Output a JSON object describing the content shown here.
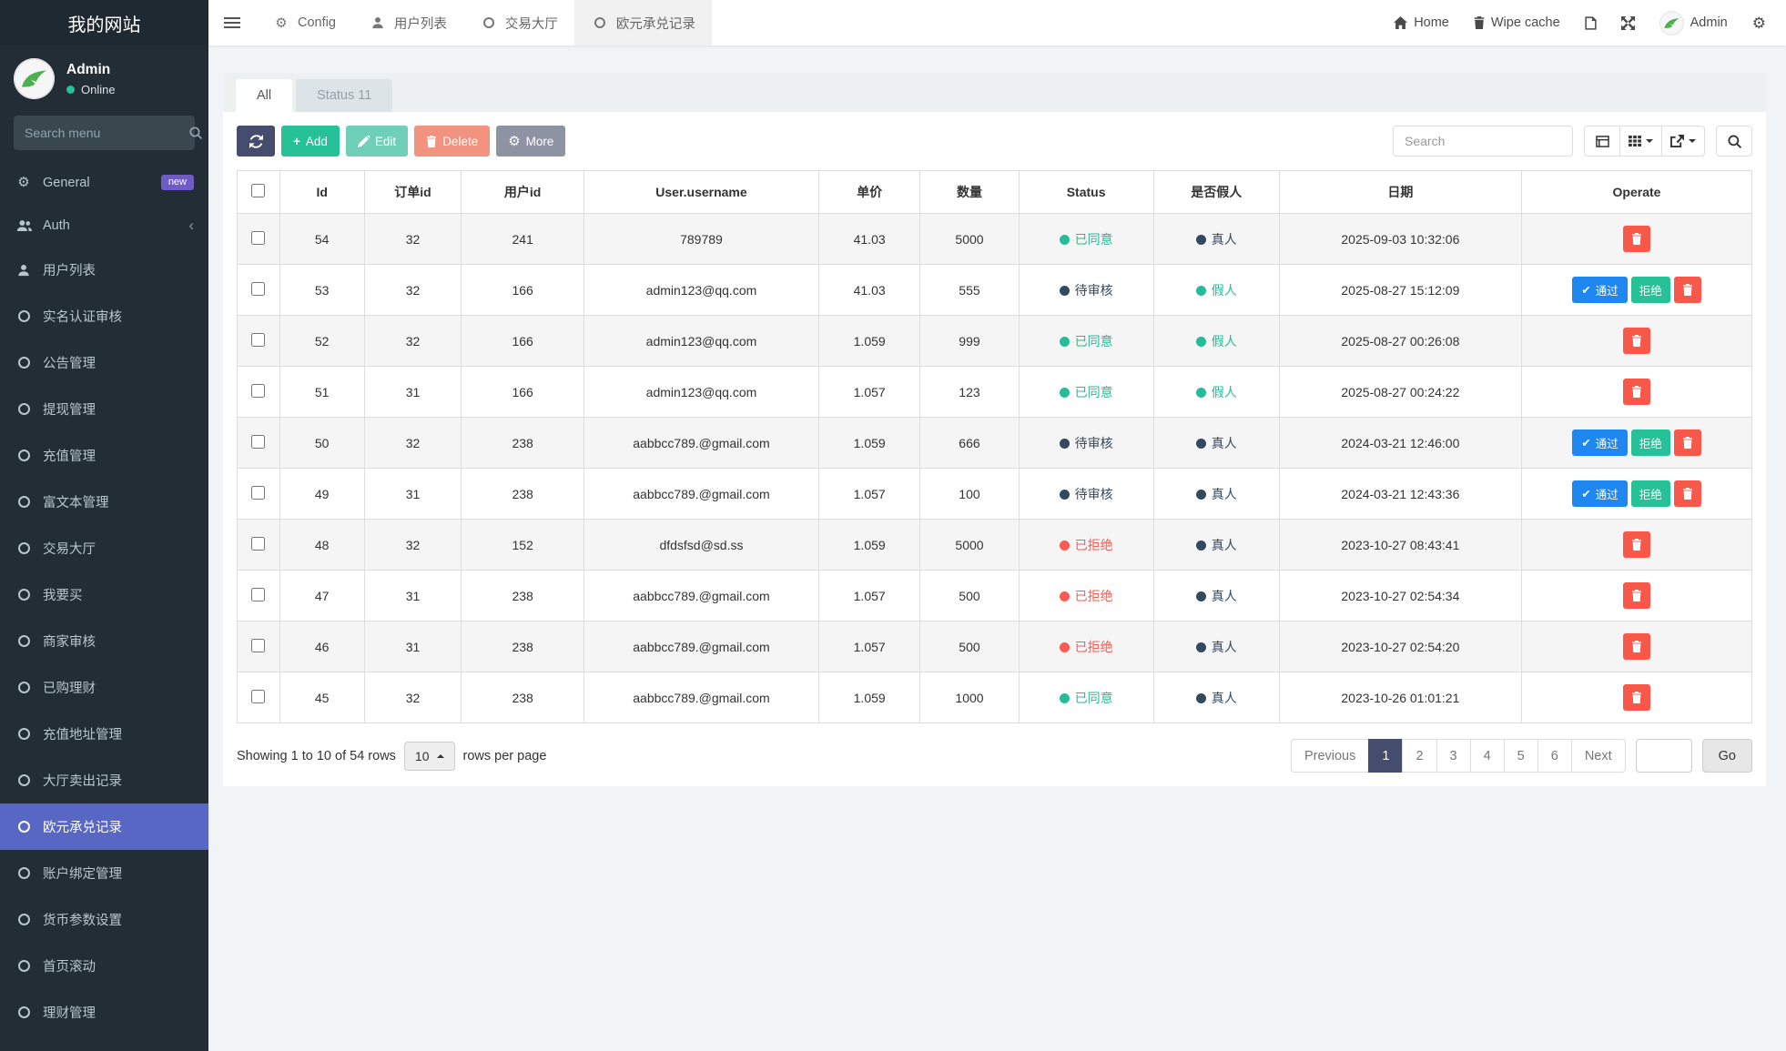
{
  "sidebar": {
    "title": "我的网站",
    "user": {
      "name": "Admin",
      "status": "Online"
    },
    "search_placeholder": "Search menu",
    "items": [
      {
        "label": "General",
        "icon": "gears-icon",
        "badge": "new"
      },
      {
        "label": "Auth",
        "icon": "users-icon",
        "chevron": true
      },
      {
        "label": "用户列表",
        "icon": "user-icon"
      },
      {
        "label": "实名认证审核",
        "icon": "circle-icon"
      },
      {
        "label": "公告管理",
        "icon": "circle-icon"
      },
      {
        "label": "提现管理",
        "icon": "circle-icon"
      },
      {
        "label": "充值管理",
        "icon": "circle-icon"
      },
      {
        "label": "富文本管理",
        "icon": "circle-icon"
      },
      {
        "label": "交易大厅",
        "icon": "circle-icon"
      },
      {
        "label": "我要买",
        "icon": "circle-icon"
      },
      {
        "label": "商家审核",
        "icon": "circle-icon"
      },
      {
        "label": "已购理财",
        "icon": "circle-icon"
      },
      {
        "label": "充值地址管理",
        "icon": "circle-icon"
      },
      {
        "label": "大厅卖出记录",
        "icon": "circle-icon"
      },
      {
        "label": "欧元承兑记录",
        "icon": "circle-icon",
        "active": true
      },
      {
        "label": "账户绑定管理",
        "icon": "circle-icon"
      },
      {
        "label": "货币参数设置",
        "icon": "circle-icon"
      },
      {
        "label": "首页滚动",
        "icon": "circle-icon"
      },
      {
        "label": "理财管理",
        "icon": "circle-icon"
      }
    ]
  },
  "topbar": {
    "tabs": [
      {
        "label": "Config",
        "icon": "gear-icon"
      },
      {
        "label": "用户列表",
        "icon": "user-icon"
      },
      {
        "label": "交易大厅",
        "icon": "circle-icon"
      },
      {
        "label": "欧元承兑记录",
        "icon": "circle-icon",
        "active": true
      }
    ],
    "home_label": "Home",
    "wipe_cache_label": "Wipe cache",
    "admin_label": "Admin"
  },
  "panel": {
    "tabs": [
      {
        "label": "All",
        "active": true
      },
      {
        "label": "Status 11"
      }
    ],
    "toolbar": {
      "add": "Add",
      "edit": "Edit",
      "delete": "Delete",
      "more": "More",
      "search_placeholder": "Search"
    }
  },
  "table": {
    "columns": [
      "Id",
      "订单id",
      "用户id",
      "User.username",
      "单价",
      "数量",
      "Status",
      "是否假人",
      "日期",
      "Operate"
    ],
    "operate_labels": {
      "approve": "通过",
      "reject": "拒绝"
    },
    "status_colors": {
      "green": "#26bd96",
      "dark": "#34495e",
      "red": "#fa5a51"
    },
    "rows": [
      {
        "id": "54",
        "order_id": "32",
        "user_id": "241",
        "username": "789789",
        "price": "41.03",
        "qty": "5000",
        "status": {
          "label": "已同意",
          "type": "green"
        },
        "fake": {
          "label": "真人",
          "type": "dark"
        },
        "date": "2025-09-03 10:32:06",
        "can_review": false
      },
      {
        "id": "53",
        "order_id": "32",
        "user_id": "166",
        "username": "admin123@qq.com",
        "price": "41.03",
        "qty": "555",
        "status": {
          "label": "待审核",
          "type": "dark"
        },
        "fake": {
          "label": "假人",
          "type": "green"
        },
        "date": "2025-08-27 15:12:09",
        "can_review": true
      },
      {
        "id": "52",
        "order_id": "32",
        "user_id": "166",
        "username": "admin123@qq.com",
        "price": "1.059",
        "qty": "999",
        "status": {
          "label": "已同意",
          "type": "green"
        },
        "fake": {
          "label": "假人",
          "type": "green"
        },
        "date": "2025-08-27 00:26:08",
        "can_review": false
      },
      {
        "id": "51",
        "order_id": "31",
        "user_id": "166",
        "username": "admin123@qq.com",
        "price": "1.057",
        "qty": "123",
        "status": {
          "label": "已同意",
          "type": "green"
        },
        "fake": {
          "label": "假人",
          "type": "green"
        },
        "date": "2025-08-27 00:24:22",
        "can_review": false
      },
      {
        "id": "50",
        "order_id": "32",
        "user_id": "238",
        "username": "aabbcc789.@gmail.com",
        "price": "1.059",
        "qty": "666",
        "status": {
          "label": "待审核",
          "type": "dark"
        },
        "fake": {
          "label": "真人",
          "type": "dark"
        },
        "date": "2024-03-21 12:46:00",
        "can_review": true
      },
      {
        "id": "49",
        "order_id": "31",
        "user_id": "238",
        "username": "aabbcc789.@gmail.com",
        "price": "1.057",
        "qty": "100",
        "status": {
          "label": "待审核",
          "type": "dark"
        },
        "fake": {
          "label": "真人",
          "type": "dark"
        },
        "date": "2024-03-21 12:43:36",
        "can_review": true
      },
      {
        "id": "48",
        "order_id": "32",
        "user_id": "152",
        "username": "dfdsfsd@sd.ss",
        "price": "1.059",
        "qty": "5000",
        "status": {
          "label": "已拒绝",
          "type": "red"
        },
        "fake": {
          "label": "真人",
          "type": "dark"
        },
        "date": "2023-10-27 08:43:41",
        "can_review": false
      },
      {
        "id": "47",
        "order_id": "31",
        "user_id": "238",
        "username": "aabbcc789.@gmail.com",
        "price": "1.057",
        "qty": "500",
        "status": {
          "label": "已拒绝",
          "type": "red"
        },
        "fake": {
          "label": "真人",
          "type": "dark"
        },
        "date": "2023-10-27 02:54:34",
        "can_review": false
      },
      {
        "id": "46",
        "order_id": "31",
        "user_id": "238",
        "username": "aabbcc789.@gmail.com",
        "price": "1.057",
        "qty": "500",
        "status": {
          "label": "已拒绝",
          "type": "red"
        },
        "fake": {
          "label": "真人",
          "type": "dark"
        },
        "date": "2023-10-27 02:54:20",
        "can_review": false
      },
      {
        "id": "45",
        "order_id": "32",
        "user_id": "238",
        "username": "aabbcc789.@gmail.com",
        "price": "1.059",
        "qty": "1000",
        "status": {
          "label": "已同意",
          "type": "green"
        },
        "fake": {
          "label": "真人",
          "type": "dark"
        },
        "date": "2023-10-26 01:01:21",
        "can_review": false
      }
    ]
  },
  "footer": {
    "showing": "Showing 1 to 10 of 54 rows",
    "page_size": "10",
    "rows_per_page_label": "rows per page",
    "prev_label": "Previous",
    "pages": [
      "1",
      "2",
      "3",
      "4",
      "5",
      "6"
    ],
    "active_page": "1",
    "next_label": "Next",
    "go_label": "Go"
  },
  "colors": {
    "accent_green": "#26c196",
    "navy": "#454c6d",
    "danger": "#f7584a",
    "approve_blue": "#1e87f0",
    "active_menu": "#5867c3",
    "badge_purple": "#6e5bc4"
  },
  "icons": {
    "gear": "⚙",
    "check": "✔",
    "chevron_left": "‹"
  }
}
